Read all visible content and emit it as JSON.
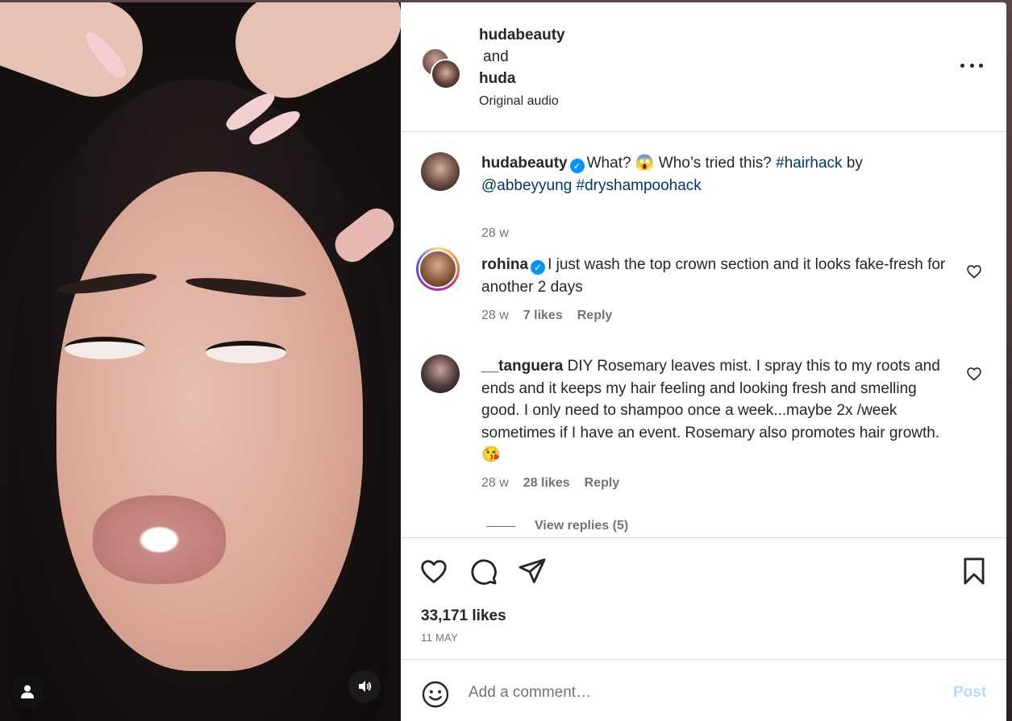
{
  "header": {
    "user1": "hudabeauty",
    "joiner": "and",
    "user2": "huda",
    "audio": "Original audio",
    "more_icon": "more-horizontal-icon"
  },
  "caption": {
    "username": "hudabeauty",
    "text_pre": "What? ",
    "emoji": "😱",
    "text_mid": " Who’s tried this? ",
    "tag1": "#hairhack",
    "by": " by ",
    "mention": "@abbeyyung",
    "space": " ",
    "tag2": "#dryshampoohack",
    "time": "28 w"
  },
  "comments": [
    {
      "username": "rohina",
      "text": "I just wash the top crown section and it looks fake-fresh for another 2 days",
      "time": "28 w",
      "likes": "7 likes",
      "reply": "Reply"
    },
    {
      "username": "__tanguera",
      "text": "DIY Rosemary leaves mist. I spray this to my roots and ends and it keeps my hair feeling and looking fresh and smelling good. I only need to shampoo once a week...maybe 2x /week sometimes if I have an event. Rosemary also promotes hair growth. ",
      "emoji": "😘",
      "time": "28 w",
      "likes": "28 likes",
      "reply": "Reply",
      "view_replies": "View replies (5)"
    }
  ],
  "actions": {
    "likes": "33,171 likes",
    "date": "11 MAY"
  },
  "composer": {
    "placeholder": "Add a comment…",
    "post": "Post"
  },
  "colors": {
    "link": "#00376b",
    "verified": "#0095f6",
    "muted": "#737373",
    "post_disabled": "#b3dbff"
  }
}
